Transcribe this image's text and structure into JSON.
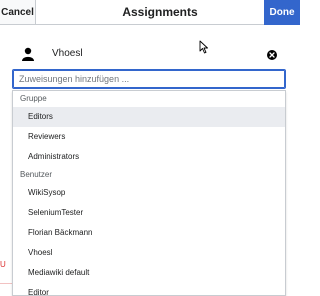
{
  "header": {
    "cancel_label": "Cancel",
    "title": "Assignments",
    "done_label": "Done"
  },
  "assignee": {
    "name": "Vhoesl"
  },
  "search": {
    "placeholder": "Zuweisungen hinzufügen ..."
  },
  "dropdown": {
    "groups": [
      {
        "label": "Gruppe",
        "items": [
          "Editors",
          "Reviewers",
          "Administrators"
        ]
      },
      {
        "label": "Benutzer",
        "items": [
          "WikiSysop",
          "SeleniumTester",
          "Florian Bäckmann",
          "Vhoesl",
          "Mediawiki default",
          "Editor"
        ]
      }
    ],
    "highlighted": "Editors"
  },
  "background": {
    "edge_char": "U"
  },
  "colors": {
    "accent": "#3366cc",
    "highlight": "#eaecf0"
  },
  "icons": {
    "user": "user-icon",
    "remove": "close-circle-icon",
    "cursor": "mouse-pointer-icon"
  }
}
